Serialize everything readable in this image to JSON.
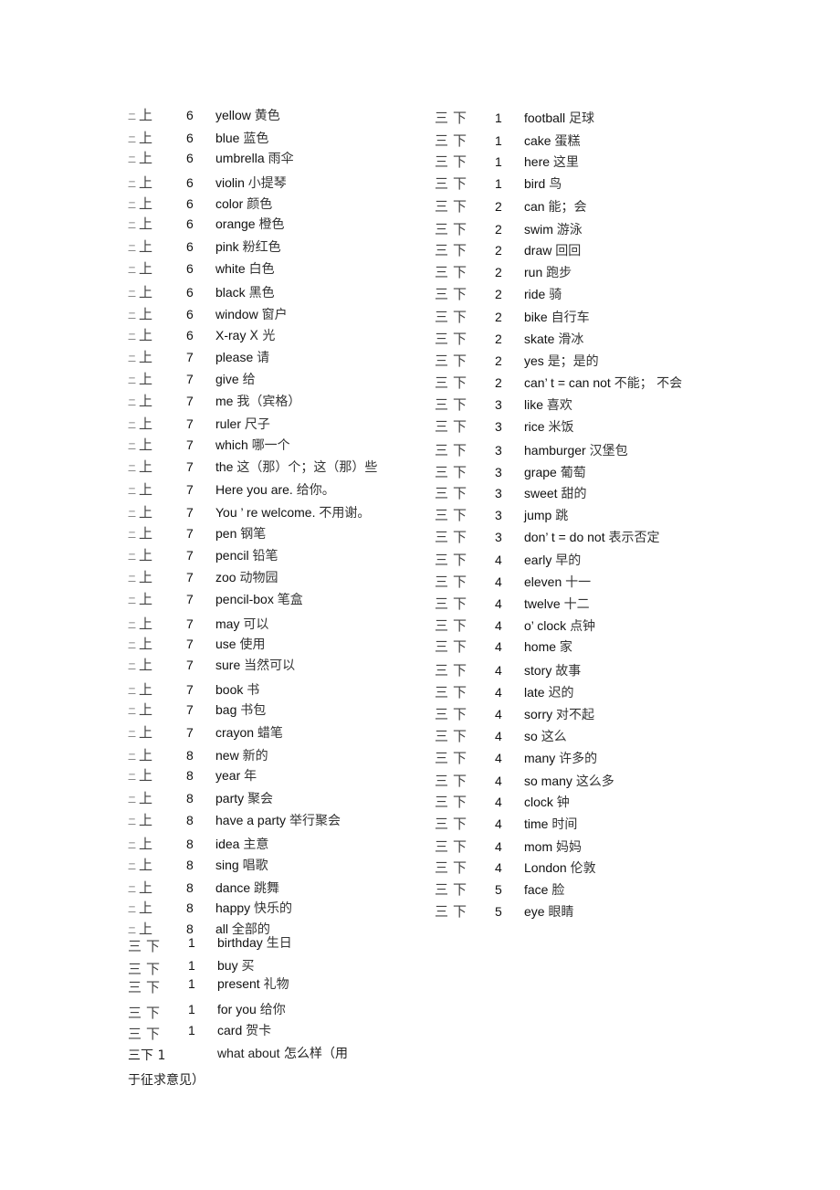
{
  "left_column": [
    {
      "grade": "二",
      "term": "上",
      "unit": "6",
      "en": "yellow",
      "zh": "黄色"
    },
    {
      "grade": "二",
      "term": "上",
      "unit": "6",
      "en": "blue",
      "zh": "蓝色"
    },
    {
      "grade": "二",
      "term": "上",
      "unit": "6",
      "en": "umbrella",
      "zh": "雨伞"
    },
    {
      "grade": "二",
      "term": "上",
      "unit": "6",
      "en": "violin",
      "zh": "小提琴"
    },
    {
      "grade": "二",
      "term": "上",
      "unit": "6",
      "en": "color",
      "zh": "颜色"
    },
    {
      "grade": "二",
      "term": "上",
      "unit": "6",
      "en": "orange",
      "zh": "橙色"
    },
    {
      "grade": "二",
      "term": "上",
      "unit": "6",
      "en": "pink",
      "zh": "粉红色"
    },
    {
      "grade": "二",
      "term": "上",
      "unit": "6",
      "en": "white",
      "zh": "白色"
    },
    {
      "grade": "二",
      "term": "上",
      "unit": "6",
      "en": "black",
      "zh": "黑色"
    },
    {
      "grade": "二",
      "term": "上",
      "unit": "6",
      "en": "window",
      "zh": "窗户"
    },
    {
      "grade": "二",
      "term": "上",
      "unit": "6",
      "en": "X-ray",
      "zh": "X 光"
    },
    {
      "grade": "二",
      "term": "上",
      "unit": "7",
      "en": "please",
      "zh": "请"
    },
    {
      "grade": "二",
      "term": "上",
      "unit": "7",
      "en": "give",
      "zh": "给"
    },
    {
      "grade": "二",
      "term": "上",
      "unit": "7",
      "en": "me",
      "zh": "我（宾格）"
    },
    {
      "grade": "二",
      "term": "上",
      "unit": "7",
      "en": "ruler",
      "zh": "尺子"
    },
    {
      "grade": "二",
      "term": "上",
      "unit": "7",
      "en": "which",
      "zh": "哪一个"
    },
    {
      "grade": "二",
      "term": "上",
      "unit": "7",
      "en": "the",
      "zh": "这（那）个；这（那）些"
    },
    {
      "grade": "二",
      "term": "上",
      "unit": "7",
      "en": "Here you are.",
      "zh": "给你。"
    },
    {
      "grade": "二",
      "term": "上",
      "unit": "7",
      "en": "You ’  re welcome.",
      "zh": "不用谢。"
    },
    {
      "grade": "二",
      "term": "上",
      "unit": "7",
      "en": "pen",
      "zh": "钢笔"
    },
    {
      "grade": "二",
      "term": "上",
      "unit": "7",
      "en": "pencil",
      "zh": "铅笔"
    },
    {
      "grade": "二",
      "term": "上",
      "unit": "7",
      "en": "zoo",
      "zh": "动物园"
    },
    {
      "grade": "二",
      "term": "上",
      "unit": "7",
      "en": "pencil-box",
      "zh": "笔盒"
    },
    {
      "grade": "二",
      "term": "上",
      "unit": "7",
      "en": "may",
      "zh": "可以"
    },
    {
      "grade": "二",
      "term": "上",
      "unit": "7",
      "en": "use",
      "zh": "使用"
    },
    {
      "grade": "二",
      "term": "上",
      "unit": "7",
      "en": "sure",
      "zh": "当然可以"
    },
    {
      "grade": "二",
      "term": "上",
      "unit": "7",
      "en": "book",
      "zh": "书"
    },
    {
      "grade": "二",
      "term": "上",
      "unit": "7",
      "en": "bag",
      "zh": "书包"
    },
    {
      "grade": "二",
      "term": "上",
      "unit": "7",
      "en": "crayon",
      "zh": "蜡笔"
    },
    {
      "grade": "二",
      "term": "上",
      "unit": "8",
      "en": "new",
      "zh": "新的"
    },
    {
      "grade": "二",
      "term": "上",
      "unit": "8",
      "en": "year",
      "zh": "年"
    },
    {
      "grade": "二",
      "term": "上",
      "unit": "8",
      "en": "party",
      "zh": "聚会"
    },
    {
      "grade": "二",
      "term": "上",
      "unit": "8",
      "en": "have a party",
      "zh": "举行聚会"
    },
    {
      "grade": "二",
      "term": "上",
      "unit": "8",
      "en": "idea",
      "zh": "主意"
    },
    {
      "grade": "二",
      "term": "上",
      "unit": "8",
      "en": "sing",
      "zh": "唱歌"
    },
    {
      "grade": "二",
      "term": "上",
      "unit": "8",
      "en": "dance",
      "zh": "跳舞"
    },
    {
      "grade": "二",
      "term": "上",
      "unit": "8",
      "en": "happy",
      "zh": "快乐的"
    },
    {
      "grade": "二",
      "term": "上",
      "unit": "8",
      "en": "all",
      "zh": "全部的"
    }
  ],
  "left_lower": [
    {
      "grade": "三",
      "term": "下",
      "unit": "1",
      "en": "birthday",
      "zh": "生日"
    },
    {
      "grade": "三",
      "term": "下",
      "unit": "1",
      "en": "buy",
      "zh": "买"
    },
    {
      "grade": "三",
      "term": "下",
      "unit": "1",
      "en": "present",
      "zh": "礼物"
    },
    {
      "grade": "三",
      "term": "下",
      "unit": "1",
      "en": "for you",
      "zh": "给你"
    },
    {
      "grade": "三",
      "term": "下",
      "unit": "1",
      "en": "card",
      "zh": "贺卡"
    }
  ],
  "left_tail": {
    "label": "三下 1",
    "en": "what about",
    "zh": "怎么样（用",
    "wrap": "于征求意见）"
  },
  "right_column": [
    {
      "grade": "三",
      "term": "下",
      "unit": "1",
      "en": "football",
      "zh": "足球"
    },
    {
      "grade": "三",
      "term": "下",
      "unit": "1",
      "en": "cake",
      "zh": "蛋糕"
    },
    {
      "grade": "三",
      "term": "下",
      "unit": "1",
      "en": "here",
      "zh": "这里"
    },
    {
      "grade": "三",
      "term": "下",
      "unit": "1",
      "en": "bird",
      "zh": "鸟"
    },
    {
      "grade": "三",
      "term": "下",
      "unit": "2",
      "en": "can",
      "zh": "能；会"
    },
    {
      "grade": "三",
      "term": "下",
      "unit": "2",
      "en": "swim",
      "zh": "游泳"
    },
    {
      "grade": "三",
      "term": "下",
      "unit": "2",
      "en": "draw",
      "zh": "回回"
    },
    {
      "grade": "三",
      "term": "下",
      "unit": "2",
      "en": "run",
      "zh": "跑步"
    },
    {
      "grade": "三",
      "term": "下",
      "unit": "2",
      "en": "ride",
      "zh": "骑"
    },
    {
      "grade": "三",
      "term": "下",
      "unit": "2",
      "en": "bike",
      "zh": "自行车"
    },
    {
      "grade": "三",
      "term": "下",
      "unit": "2",
      "en": "skate",
      "zh": "滑冰"
    },
    {
      "grade": "三",
      "term": "下",
      "unit": "2",
      "en": "yes",
      "zh": "是；是的"
    },
    {
      "grade": "三",
      "term": "下",
      "unit": "2",
      "en": "can’  t = can not",
      "zh": "不能；  不会"
    },
    {
      "grade": "三",
      "term": "下",
      "unit": "3",
      "en": "like",
      "zh": "喜欢"
    },
    {
      "grade": "三",
      "term": "下",
      "unit": "3",
      "en": "rice",
      "zh": "米饭"
    },
    {
      "grade": "三",
      "term": "下",
      "unit": "3",
      "en": "hamburger",
      "zh": "汉堡包"
    },
    {
      "grade": "三",
      "term": "下",
      "unit": "3",
      "en": "grape",
      "zh": "葡萄"
    },
    {
      "grade": "三",
      "term": "下",
      "unit": "3",
      "en": "sweet",
      "zh": "甜的"
    },
    {
      "grade": "三",
      "term": "下",
      "unit": "3",
      "en": "jump",
      "zh": "跳"
    },
    {
      "grade": "三",
      "term": "下",
      "unit": "3",
      "en": "don’  t = do not",
      "zh": "表示否定"
    },
    {
      "grade": "三",
      "term": "下",
      "unit": "4",
      "en": "early",
      "zh": "早的"
    },
    {
      "grade": "三",
      "term": "下",
      "unit": "4",
      "en": "eleven",
      "zh": "十一"
    },
    {
      "grade": "三",
      "term": "下",
      "unit": "4",
      "en": "twelve",
      "zh": "十二"
    },
    {
      "grade": "三",
      "term": "下",
      "unit": "4",
      "en": "o’  clock",
      "zh": "点钟"
    },
    {
      "grade": "三",
      "term": "下",
      "unit": "4",
      "en": "home",
      "zh": "家"
    },
    {
      "grade": "三",
      "term": "下",
      "unit": "4",
      "en": "story",
      "zh": "故事"
    },
    {
      "grade": "三",
      "term": "下",
      "unit": "4",
      "en": "late",
      "zh": "迟的"
    },
    {
      "grade": "三",
      "term": "下",
      "unit": "4",
      "en": "sorry",
      "zh": "对不起"
    },
    {
      "grade": "三",
      "term": "下",
      "unit": "4",
      "en": "so",
      "zh": "这么"
    },
    {
      "grade": "三",
      "term": "下",
      "unit": "4",
      "en": "many",
      "zh": "许多的"
    },
    {
      "grade": "三",
      "term": "下",
      "unit": "4",
      "en": "so many",
      "zh": "这么多"
    },
    {
      "grade": "三",
      "term": "下",
      "unit": "4",
      "en": "clock",
      "zh": "钟"
    },
    {
      "grade": "三",
      "term": "下",
      "unit": "4",
      "en": "time",
      "zh": "时间"
    },
    {
      "grade": "三",
      "term": "下",
      "unit": "4",
      "en": "mom",
      "zh": "妈妈"
    },
    {
      "grade": "三",
      "term": "下",
      "unit": "4",
      "en": "London",
      "zh": "伦敦"
    },
    {
      "grade": "三",
      "term": "下",
      "unit": "5",
      "en": "face",
      "zh": "脸"
    },
    {
      "grade": "三",
      "term": "下",
      "unit": "5",
      "en": "eye",
      "zh": "眼睛"
    }
  ]
}
